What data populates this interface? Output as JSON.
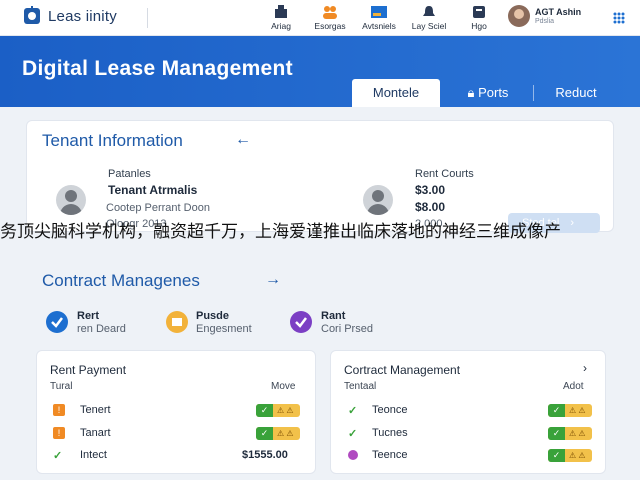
{
  "app": {
    "name": "Leas iinity"
  },
  "nav": [
    {
      "label": "Ariag",
      "icon": "home-icon"
    },
    {
      "label": "Esorgas",
      "icon": "people-icon"
    },
    {
      "label": "Avtsniels",
      "icon": "flag-icon"
    },
    {
      "label": "Lay Sciel",
      "icon": "bell-icon"
    },
    {
      "label": "Hgo",
      "icon": "help-icon"
    }
  ],
  "user": {
    "name": "AGT Ashin",
    "role": "Pdslia"
  },
  "header": {
    "title": "Digital Lease Management",
    "tabs": [
      {
        "label": "Montele",
        "active": true
      },
      {
        "label": "Ports",
        "icon": "lock-icon"
      },
      {
        "label": "Reduct"
      }
    ]
  },
  "tenant": {
    "title": "Tenant Information",
    "left": {
      "label": "Patanles",
      "name": "Tenant Atrmalis",
      "line1": "Cootep Perrant Doon",
      "line2": "Oloogr 2013"
    },
    "right": {
      "label": "Rent Courts",
      "v1": "$3.00",
      "v2": "$8.00",
      "v3": "2.000"
    },
    "button": "Sted tel"
  },
  "ticker": "务顶尖脑科学机构，融资超千万，上海爱谨推出临床落地的神经三维成像产",
  "contract": {
    "title": "Contract Managenes",
    "status": [
      {
        "t1": "Rert",
        "t2": "ren Deard",
        "color": "#1d6fd0"
      },
      {
        "t1": "Pusde",
        "t2": "Engesment",
        "color": "#f2b23a"
      },
      {
        "t1": "Rant",
        "t2": "Cori Prsed",
        "color": "#7b3fc4"
      }
    ]
  },
  "rent_payment": {
    "title": "Rent Payment",
    "col1": "Tural",
    "col2": "Move",
    "rows": [
      {
        "label": "Tenert",
        "icon": "warning-icon",
        "pill_text": "⚠ ⚠"
      },
      {
        "label": "Tanart",
        "icon": "warning-icon",
        "pill_text": "⚠ ⚠"
      },
      {
        "label": "Intect",
        "icon": "check-icon",
        "amount": "$1555.00"
      }
    ]
  },
  "contract_mgmt": {
    "title": "Cortract Management",
    "col1": "Tentaal",
    "col2": "Adot",
    "rows": [
      {
        "label": "Teonce",
        "icon": "check-icon",
        "pill_text": "⚠ ⚠"
      },
      {
        "label": "Tucnes",
        "icon": "check-icon",
        "pill_text": "⚠ ⚠"
      },
      {
        "label": "Teence",
        "icon": "dot-icon",
        "pill_text": "⚠ ⚠"
      }
    ]
  }
}
